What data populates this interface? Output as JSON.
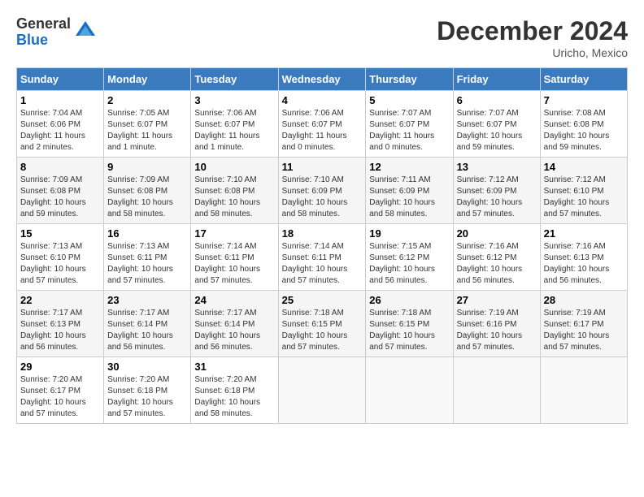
{
  "logo": {
    "general": "General",
    "blue": "Blue"
  },
  "header": {
    "month": "December 2024",
    "location": "Uricho, Mexico"
  },
  "weekdays": [
    "Sunday",
    "Monday",
    "Tuesday",
    "Wednesday",
    "Thursday",
    "Friday",
    "Saturday"
  ],
  "weeks": [
    [
      {
        "day": "1",
        "sunrise": "7:04 AM",
        "sunset": "6:06 PM",
        "daylight": "11 hours and 2 minutes."
      },
      {
        "day": "2",
        "sunrise": "7:05 AM",
        "sunset": "6:07 PM",
        "daylight": "11 hours and 1 minute."
      },
      {
        "day": "3",
        "sunrise": "7:06 AM",
        "sunset": "6:07 PM",
        "daylight": "11 hours and 1 minute."
      },
      {
        "day": "4",
        "sunrise": "7:06 AM",
        "sunset": "6:07 PM",
        "daylight": "11 hours and 0 minutes."
      },
      {
        "day": "5",
        "sunrise": "7:07 AM",
        "sunset": "6:07 PM",
        "daylight": "11 hours and 0 minutes."
      },
      {
        "day": "6",
        "sunrise": "7:07 AM",
        "sunset": "6:07 PM",
        "daylight": "10 hours and 59 minutes."
      },
      {
        "day": "7",
        "sunrise": "7:08 AM",
        "sunset": "6:08 PM",
        "daylight": "10 hours and 59 minutes."
      }
    ],
    [
      {
        "day": "8",
        "sunrise": "7:09 AM",
        "sunset": "6:08 PM",
        "daylight": "10 hours and 59 minutes."
      },
      {
        "day": "9",
        "sunrise": "7:09 AM",
        "sunset": "6:08 PM",
        "daylight": "10 hours and 58 minutes."
      },
      {
        "day": "10",
        "sunrise": "7:10 AM",
        "sunset": "6:08 PM",
        "daylight": "10 hours and 58 minutes."
      },
      {
        "day": "11",
        "sunrise": "7:10 AM",
        "sunset": "6:09 PM",
        "daylight": "10 hours and 58 minutes."
      },
      {
        "day": "12",
        "sunrise": "7:11 AM",
        "sunset": "6:09 PM",
        "daylight": "10 hours and 58 minutes."
      },
      {
        "day": "13",
        "sunrise": "7:12 AM",
        "sunset": "6:09 PM",
        "daylight": "10 hours and 57 minutes."
      },
      {
        "day": "14",
        "sunrise": "7:12 AM",
        "sunset": "6:10 PM",
        "daylight": "10 hours and 57 minutes."
      }
    ],
    [
      {
        "day": "15",
        "sunrise": "7:13 AM",
        "sunset": "6:10 PM",
        "daylight": "10 hours and 57 minutes."
      },
      {
        "day": "16",
        "sunrise": "7:13 AM",
        "sunset": "6:11 PM",
        "daylight": "10 hours and 57 minutes."
      },
      {
        "day": "17",
        "sunrise": "7:14 AM",
        "sunset": "6:11 PM",
        "daylight": "10 hours and 57 minutes."
      },
      {
        "day": "18",
        "sunrise": "7:14 AM",
        "sunset": "6:11 PM",
        "daylight": "10 hours and 57 minutes."
      },
      {
        "day": "19",
        "sunrise": "7:15 AM",
        "sunset": "6:12 PM",
        "daylight": "10 hours and 56 minutes."
      },
      {
        "day": "20",
        "sunrise": "7:16 AM",
        "sunset": "6:12 PM",
        "daylight": "10 hours and 56 minutes."
      },
      {
        "day": "21",
        "sunrise": "7:16 AM",
        "sunset": "6:13 PM",
        "daylight": "10 hours and 56 minutes."
      }
    ],
    [
      {
        "day": "22",
        "sunrise": "7:17 AM",
        "sunset": "6:13 PM",
        "daylight": "10 hours and 56 minutes."
      },
      {
        "day": "23",
        "sunrise": "7:17 AM",
        "sunset": "6:14 PM",
        "daylight": "10 hours and 56 minutes."
      },
      {
        "day": "24",
        "sunrise": "7:17 AM",
        "sunset": "6:14 PM",
        "daylight": "10 hours and 56 minutes."
      },
      {
        "day": "25",
        "sunrise": "7:18 AM",
        "sunset": "6:15 PM",
        "daylight": "10 hours and 57 minutes."
      },
      {
        "day": "26",
        "sunrise": "7:18 AM",
        "sunset": "6:15 PM",
        "daylight": "10 hours and 57 minutes."
      },
      {
        "day": "27",
        "sunrise": "7:19 AM",
        "sunset": "6:16 PM",
        "daylight": "10 hours and 57 minutes."
      },
      {
        "day": "28",
        "sunrise": "7:19 AM",
        "sunset": "6:17 PM",
        "daylight": "10 hours and 57 minutes."
      }
    ],
    [
      {
        "day": "29",
        "sunrise": "7:20 AM",
        "sunset": "6:17 PM",
        "daylight": "10 hours and 57 minutes."
      },
      {
        "day": "30",
        "sunrise": "7:20 AM",
        "sunset": "6:18 PM",
        "daylight": "10 hours and 57 minutes."
      },
      {
        "day": "31",
        "sunrise": "7:20 AM",
        "sunset": "6:18 PM",
        "daylight": "10 hours and 58 minutes."
      },
      null,
      null,
      null,
      null
    ]
  ]
}
